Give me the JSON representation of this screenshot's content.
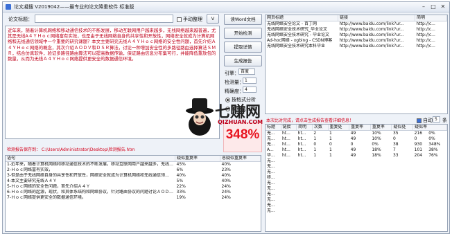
{
  "window": {
    "title": "论文凝搜 V2019042——最专业的论文降重软件 标准版",
    "minimize": "–",
    "maximize": "□",
    "close": "✕"
  },
  "topic": {
    "label": "论文标题：",
    "value": "",
    "manual_label": "手动整理",
    "v_button": "V"
  },
  "abstract_red": "近年来，随着计算机网络和移动通信技术的不断发展，移动互联网用户越来越多，无线网络越来越普遍，尤其是无线A４Ｙ‌Ｈｏｃ网络富有实效，也是由于无线网络自身的共享性和开放性，网络安全就成为计算机网络和无线通信领域中一个重要的研究课题？本文主要研究无线Ａ４Ｙ‌Ｈｏｃ网络的安全性问题，首先介绍Ａ４Ｙ‌Ｈｏｃ网络的概念，其次介绍ＡＯＤＶ和ＤＳＲ算法，讨论一种增加安全性的多路径路由选择算法ＳＭＲ，结合仿真软件，验证多路径路由算法可以提高数据传输，保证路由信息分布集可行，并能降低重放包的数量，从而为无线Ａ４Ｙ‌Ｈｏｃ网络提供更安全的数据通信环境。",
  "buttons": {
    "read_word": "读Word文档",
    "start_check": "开始检测",
    "extract_detail": "提取详情",
    "generate_report": "生成报告"
  },
  "options": {
    "engine_label": "引擎：",
    "engine_value": "百度",
    "check_count_label": "检测量：",
    "check_count_value": "1",
    "precision_label": "精确度：",
    "precision_value": "4",
    "radio1": "按格式分析",
    "radio2": "按字数分析"
  },
  "score": {
    "value": "348%"
  },
  "report_path": "检测报告保存到： C:\\Users\\Administrator\\Desktop\\检测报告.htm",
  "left_table": {
    "headers": [
      "语句",
      "疑似重复率",
      "总疑似重复率"
    ],
    "rows": [
      [
        "1-近年来，随着计算机网络和移动通信技术的不断发展，移动互联网用户越来越多，无线…",
        "45%",
        "40%"
      ],
      [
        "2-Ｈｏｃ网络富有实效，",
        "6%",
        "23%"
      ],
      [
        "3-但是由于无线网络自身的共享性和开放性，网络安全就成为计算机网络和无线通信领…",
        "40%",
        "40%"
      ],
      [
        "4-本文主要研究无线Ａ４Ｙ",
        "5%",
        "40%"
      ],
      [
        "5-Ｈｏｃ网络的安全性问题，首先介绍Ａ４Ｙ",
        "22%",
        "24%"
      ],
      [
        "6-Ｈｏｃ网络的起源，现状，和其体系结构和网络协议，针对路由协议的问题讨论ＡＯＤ…",
        "33%",
        "24%"
      ],
      [
        "7-Ｈｏｃ网络提供更安全的数据通信环境。",
        "19%",
        "24%"
      ]
    ]
  },
  "right_top_table": {
    "headers": [
      "网页标题",
      "链接",
      "简明"
    ],
    "rows": [
      [
        "无线网络安全论文 - 百丁网",
        "http://www.baidu.com/link?ur...",
        "http://c..."
      ],
      [
        "无线网络安全技术研究_毕业论文",
        "http://www.baidu.com/link?ur...",
        "http://c..."
      ],
      [
        "无线网络安全技术研究 - 毕业论文",
        "http://www.baidu.com/link?ur...",
        "http://c..."
      ],
      [
        "Ad-hoc网络 - xgbing - CSDN博客",
        "http://www.baidu.com/link?ur...",
        "http://c..."
      ],
      [
        "无线网络安全技术研究本科毕业",
        "http://www.baidu.com/link?ur...",
        "http://c..."
      ]
    ]
  },
  "mid_notice": "本次比对完成，请点击生成报告查看详细信息！",
  "auto": {
    "label": "自动",
    "value": "5",
    "unit": "条"
  },
  "right_bottom_table": {
    "headers": [
      "标题",
      "链接",
      "简明",
      "次数",
      "重复处",
      "重复率",
      "重复率",
      "疑似处",
      "疑似率"
    ],
    "rows": [
      [
        "无...",
        "ht...",
        "ht...",
        "2",
        "1",
        "49",
        "10%",
        "35",
        "216",
        "0%"
      ],
      [
        "无...",
        "ht...",
        "ht...",
        "1",
        "1",
        "49",
        "10%",
        "0",
        "0",
        "0%"
      ],
      [
        "无...",
        "ht...",
        "ht...",
        "0",
        "0",
        "0",
        "0%",
        "38",
        "930",
        "348%"
      ],
      [
        "A...",
        "ht...",
        "ht...",
        "1",
        "1",
        "49",
        "18%",
        "7",
        "101",
        "38%"
      ],
      [
        "毕...",
        "ht...",
        "ht...",
        "1",
        "1",
        "49",
        "18%",
        "33",
        "204",
        "76%"
      ],
      [
        "无...",
        "",
        "",
        "",
        "",
        "",
        "",
        "",
        "",
        ""
      ],
      [
        "无...",
        "",
        "",
        "",
        "",
        "",
        "",
        "",
        "",
        ""
      ],
      [
        "无...",
        "",
        "",
        "",
        "",
        "",
        "",
        "",
        "",
        ""
      ],
      [
        "移...",
        "",
        "",
        "",
        "",
        "",
        "",
        "",
        "",
        ""
      ],
      [
        "无...",
        "",
        "",
        "",
        "",
        "",
        "",
        "",
        "",
        ""
      ],
      [
        "无...",
        "",
        "",
        "",
        "",
        "",
        "",
        "",
        "",
        ""
      ],
      [
        "无...",
        "",
        "",
        "",
        "",
        "",
        "",
        "",
        "",
        ""
      ],
      [
        "无...",
        "",
        "",
        "",
        "",
        "",
        "",
        "",
        "",
        ""
      ],
      [
        "无...",
        "",
        "",
        "",
        "",
        "",
        "",
        "",
        "",
        ""
      ],
      [
        "无...",
        "",
        "",
        "",
        "",
        "",
        "",
        "",
        "",
        ""
      ]
    ]
  },
  "watermark": {
    "text": "七赚网",
    "sub": "QIZHUAN.COM"
  }
}
